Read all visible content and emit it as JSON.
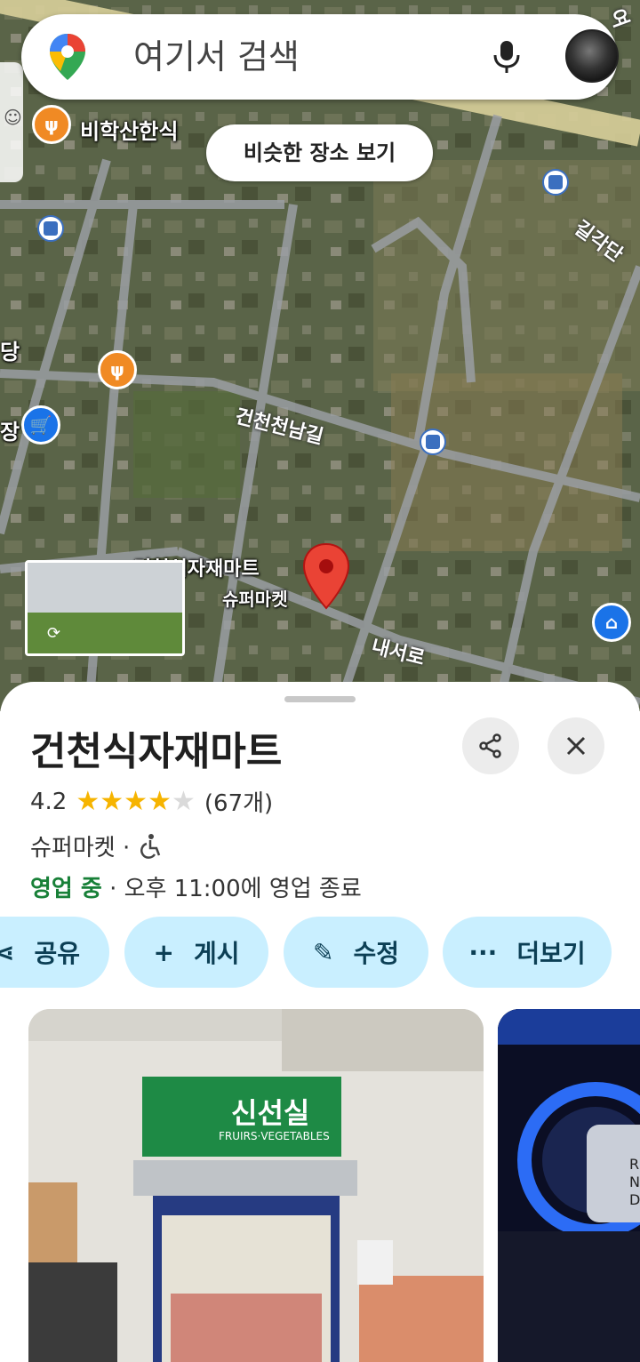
{
  "search": {
    "placeholder": "여기서 검색"
  },
  "map": {
    "similar_places_button": "비슷한 장소 보기",
    "labels": {
      "restaurant_top": "비학산한식",
      "left_partial_1": "당",
      "left_partial_2": "장",
      "road_1": "건천천남길",
      "road_2": "내서로",
      "road_3": "길각단",
      "road_top_right": "여",
      "place_name": "건천식자재마트",
      "place_category": "슈퍼마켓"
    }
  },
  "place": {
    "title": "건천식자재마트",
    "rating": "4.2",
    "rating_value": 4.2,
    "review_count": "(67개)",
    "category": "슈퍼마켓 ·",
    "open_status": "영업 중",
    "hours": "· 오후 11:00에 영업 종료"
  },
  "actions": [
    {
      "label": "공유",
      "icon": "share-icon"
    },
    {
      "label": "게시",
      "icon": "plus-icon"
    },
    {
      "label": "수정",
      "icon": "pencil-icon"
    },
    {
      "label": "더보기",
      "icon": "more-icon"
    }
  ],
  "photos": {
    "sign_korean": "신선실",
    "sign_english": "FRUIRS·VEGETABLES"
  },
  "colors": {
    "open_green": "#188038",
    "chip_bg": "#c9efff",
    "star": "#f6b400",
    "pin_red": "#ea4335"
  }
}
